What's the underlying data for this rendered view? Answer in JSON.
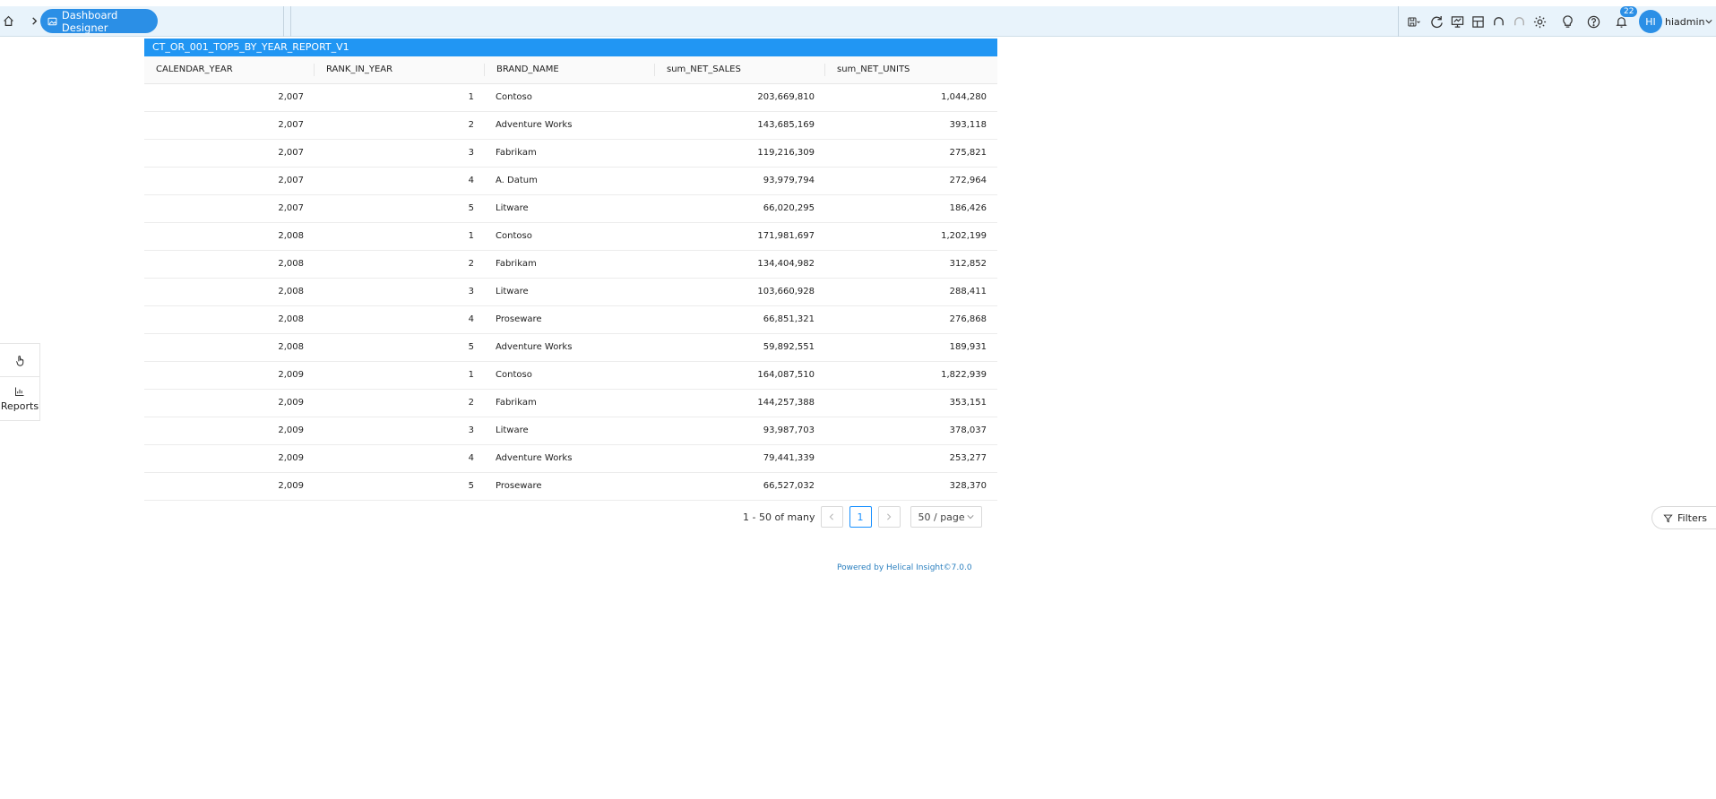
{
  "header": {
    "app_title": "Dashboard Designer",
    "notification_count": "22",
    "avatar_initials": "HI",
    "username": "hiadmin"
  },
  "report": {
    "title": "CT_OR_001_TOP5_BY_YEAR_REPORT_V1",
    "columns": [
      "CALENDAR_YEAR",
      "RANK_IN_YEAR",
      "BRAND_NAME",
      "sum_NET_SALES",
      "sum_NET_UNITS"
    ],
    "rows": [
      [
        "2,007",
        "1",
        "Contoso",
        "203,669,810",
        "1,044,280"
      ],
      [
        "2,007",
        "2",
        "Adventure Works",
        "143,685,169",
        "393,118"
      ],
      [
        "2,007",
        "3",
        "Fabrikam",
        "119,216,309",
        "275,821"
      ],
      [
        "2,007",
        "4",
        "A. Datum",
        "93,979,794",
        "272,964"
      ],
      [
        "2,007",
        "5",
        "Litware",
        "66,020,295",
        "186,426"
      ],
      [
        "2,008",
        "1",
        "Contoso",
        "171,981,697",
        "1,202,199"
      ],
      [
        "2,008",
        "2",
        "Fabrikam",
        "134,404,982",
        "312,852"
      ],
      [
        "2,008",
        "3",
        "Litware",
        "103,660,928",
        "288,411"
      ],
      [
        "2,008",
        "4",
        "Proseware",
        "66,851,321",
        "276,868"
      ],
      [
        "2,008",
        "5",
        "Adventure Works",
        "59,892,551",
        "189,931"
      ],
      [
        "2,009",
        "1",
        "Contoso",
        "164,087,510",
        "1,822,939"
      ],
      [
        "2,009",
        "2",
        "Fabrikam",
        "144,257,388",
        "353,151"
      ],
      [
        "2,009",
        "3",
        "Litware",
        "93,987,703",
        "378,037"
      ],
      [
        "2,009",
        "4",
        "Adventure Works",
        "79,441,339",
        "253,277"
      ],
      [
        "2,009",
        "5",
        "Proseware",
        "66,527,032",
        "328,370"
      ]
    ]
  },
  "pagination": {
    "range_text": "1 - 50 of many",
    "current_page": "1",
    "page_size": "50 / page"
  },
  "footer": {
    "text": "Powered by Helical Insight©7.0.0"
  },
  "sidebar": {
    "reports_label": "Reports"
  },
  "filters_label": "Filters",
  "colors": {
    "accent": "#2196f3",
    "pill": "#2b8fe6",
    "topbar": "#e8f3fb"
  }
}
